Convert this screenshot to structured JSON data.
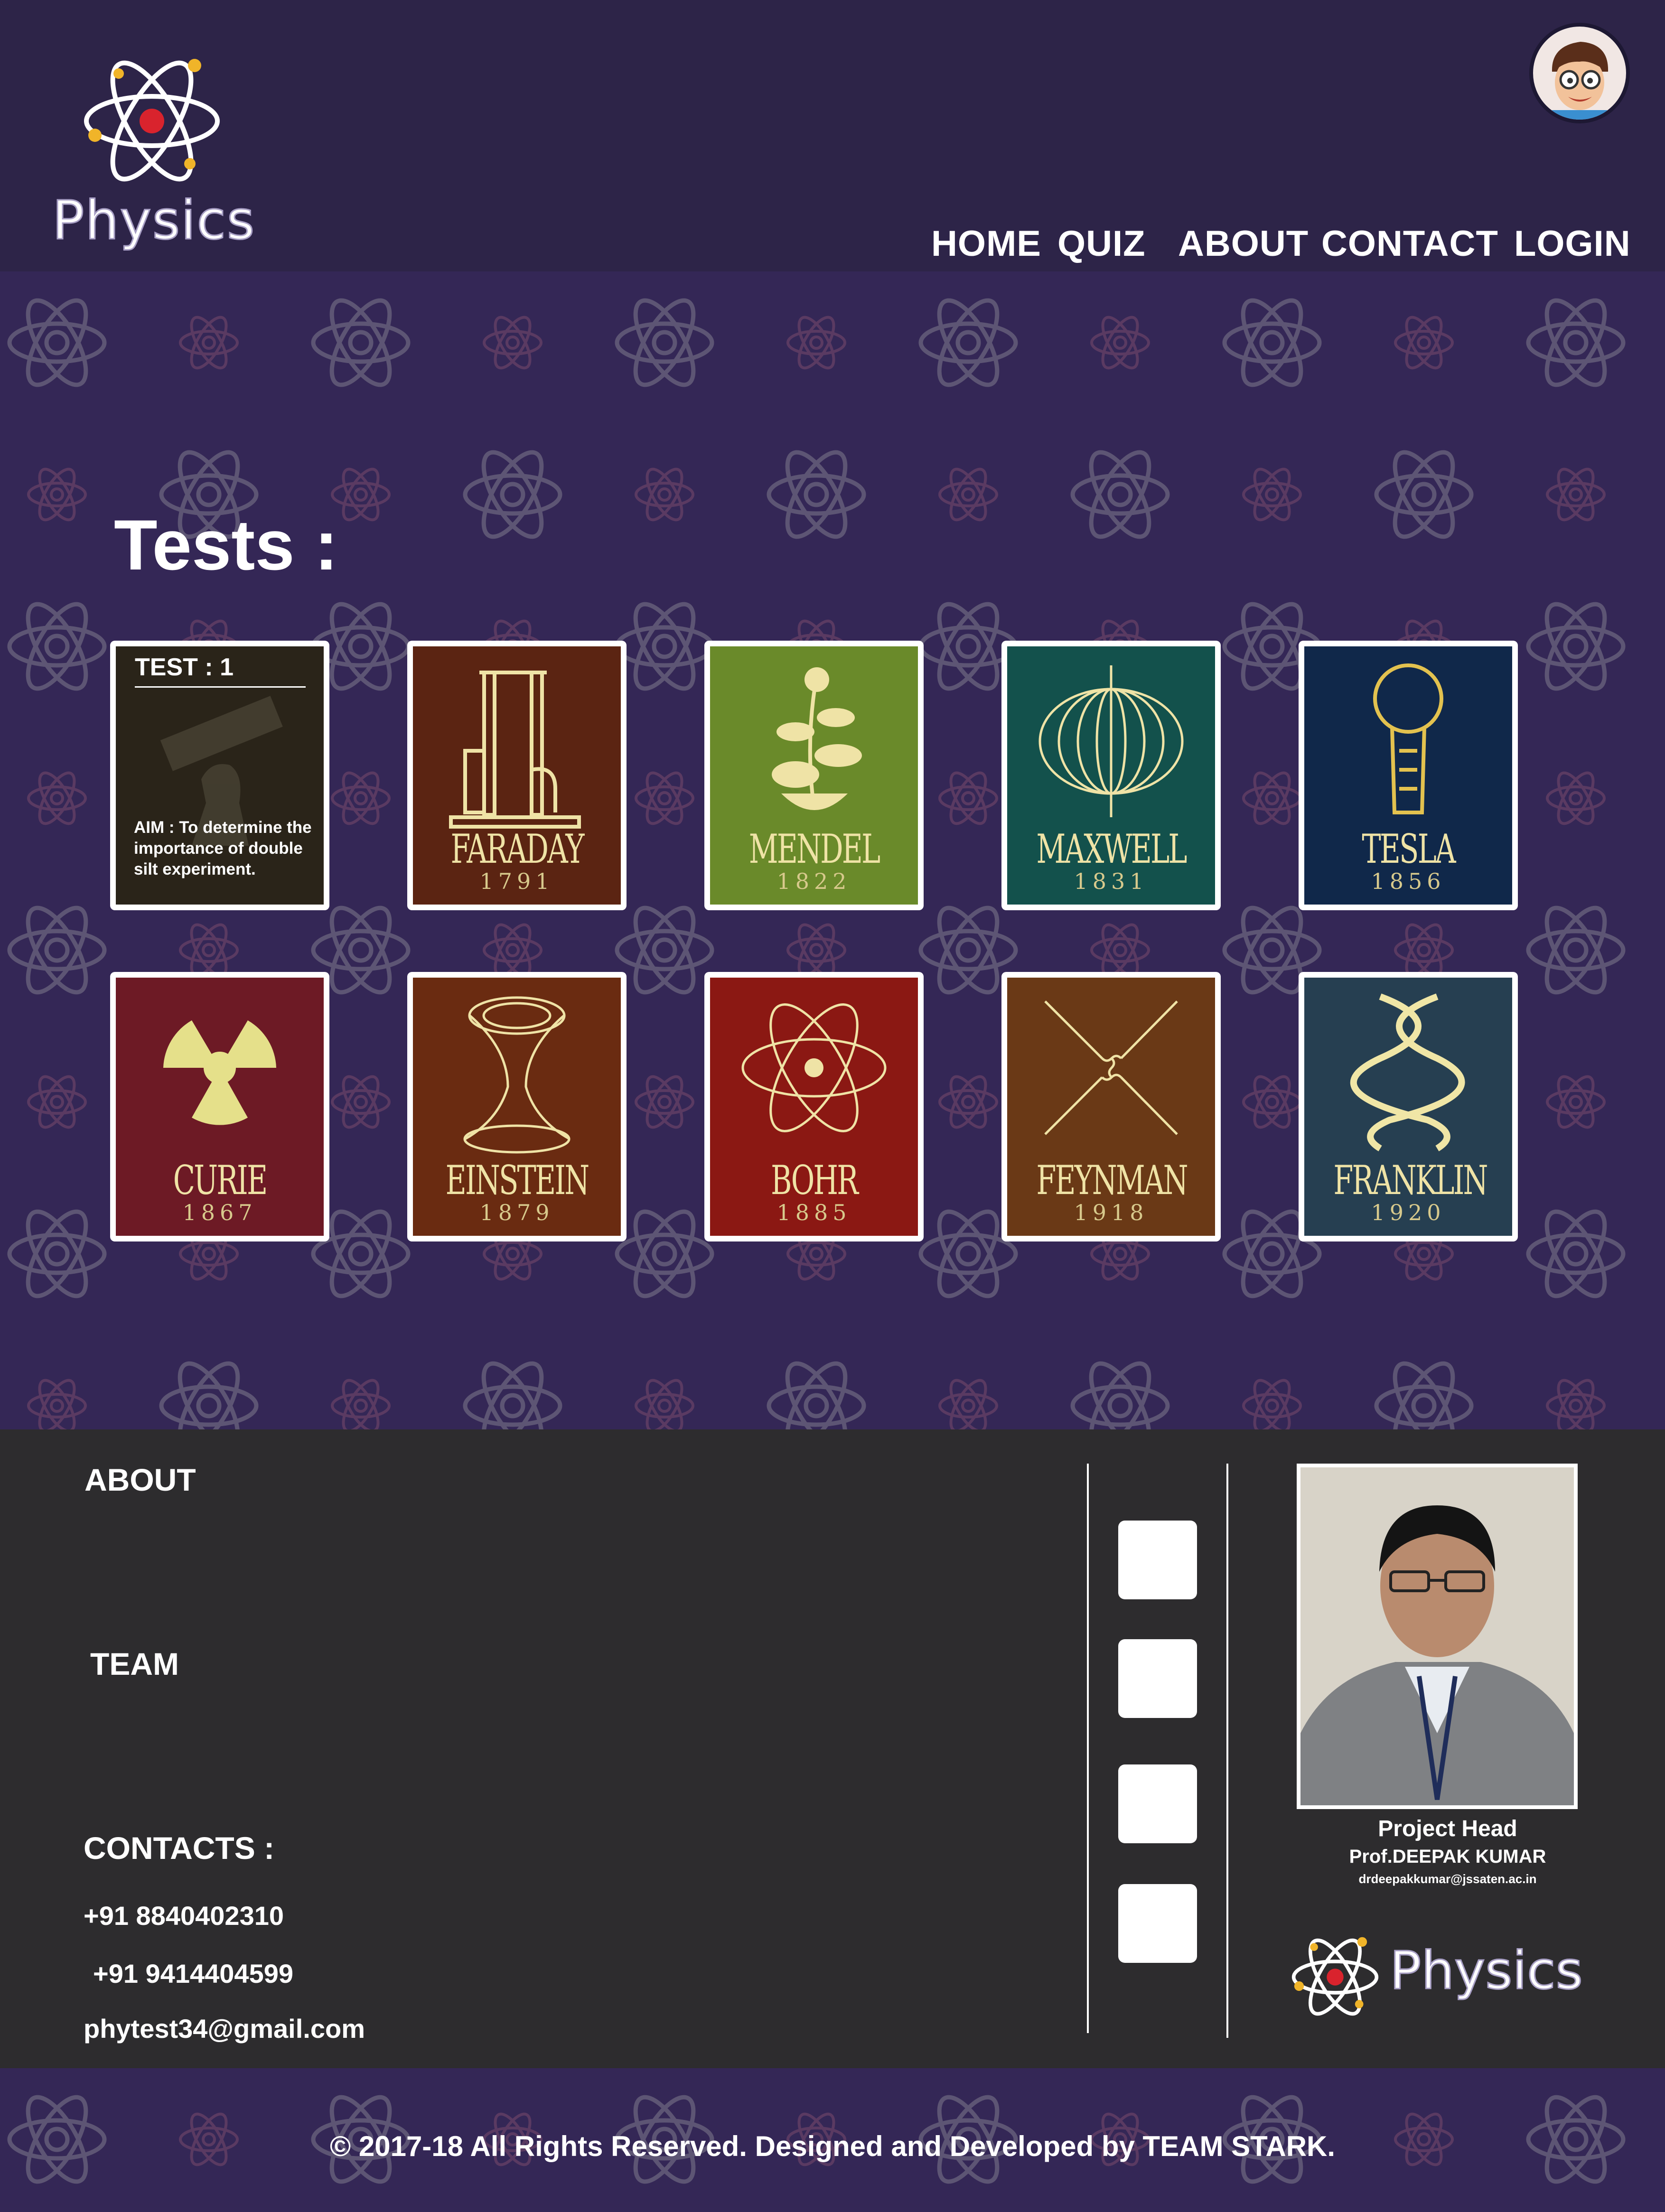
{
  "header": {
    "logo_text": "Physics",
    "nav": [
      {
        "label": "HOME"
      },
      {
        "label": "QUIZ"
      },
      {
        "label": "ABOUT"
      },
      {
        "label": "CONTACT"
      },
      {
        "label": "LOGIN"
      }
    ]
  },
  "main": {
    "title": "Tests :",
    "test_card": {
      "heading": "TEST : 1",
      "aim": "AIM : To determine the importance of double silt experiment."
    },
    "cards": [
      {
        "name": "FARADAY",
        "year": "1791",
        "bg": "#5b2412",
        "icon": "apparatus-icon"
      },
      {
        "name": "MENDEL",
        "year": "1822",
        "bg": "#6f8b2c",
        "icon": "plant-icon"
      },
      {
        "name": "MAXWELL",
        "year": "1831",
        "bg": "#14524d",
        "icon": "magnetic-field-icon"
      },
      {
        "name": "TESLA",
        "year": "1856",
        "bg": "#102947",
        "icon": "lightbulb-icon"
      },
      {
        "name": "CURIE",
        "year": "1867",
        "bg": "#6e1a25",
        "icon": "radiation-icon"
      },
      {
        "name": "EINSTEIN",
        "year": "1879",
        "bg": "#6b2c12",
        "icon": "wormhole-icon"
      },
      {
        "name": "BOHR",
        "year": "1885",
        "bg": "#8d1814",
        "icon": "atom-icon"
      },
      {
        "name": "FEYNMAN",
        "year": "1918",
        "bg": "#6a3a16",
        "icon": "feynman-diagram-icon"
      },
      {
        "name": "FRANKLIN",
        "year": "1920",
        "bg": "#264052",
        "icon": "dna-icon"
      }
    ]
  },
  "footer": {
    "about": "ABOUT",
    "team": "TEAM",
    "contacts": "CONTACTS :",
    "phone1": "+91 8840402310",
    "phone2": "+91 9414404599",
    "email": "phytest34@gmail.com",
    "project_head_title": "Project Head",
    "project_head_name": "Prof.DEEPAK KUMAR",
    "project_head_email": "drdeepakkumar@jssaten.ac.in",
    "logo_text": "Physics"
  },
  "copyright": "© 2017-18 All Rights Reserved. Designed and Developed by TEAM STARK.",
  "colors": {
    "header_bg": "#2d2448",
    "main_bg": "#342756",
    "footer_bg": "#2d2c2e",
    "accent_gold": "#efe3a6"
  }
}
